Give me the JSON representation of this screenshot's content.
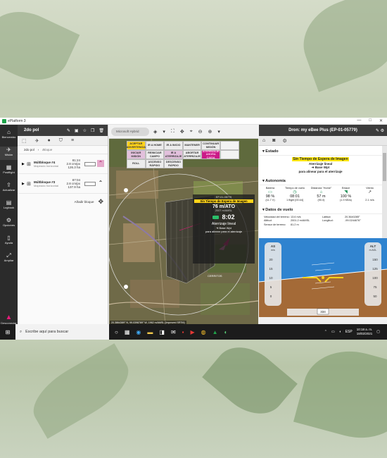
{
  "window": {
    "title": "ePlatform 3",
    "controls": [
      "—",
      "□",
      "✕"
    ]
  },
  "nav": {
    "items": [
      {
        "label": "Bienvenido",
        "icon": "home-icon"
      },
      {
        "label": "Misión",
        "icon": "route-icon"
      },
      {
        "label": "Postflight",
        "icon": "postflight-icon"
      },
      {
        "label": "Actualizar",
        "icon": "upload-icon"
      },
      {
        "label": "Logbook",
        "icon": "logbook-icon"
      },
      {
        "label": "Opciones",
        "icon": "gear-icon"
      },
      {
        "label": "Ayuda",
        "icon": "book-icon"
      },
      {
        "label": "Ampliar",
        "icon": "expand-icon"
      }
    ],
    "disconnect": {
      "label": "Desconectar",
      "icon": "drone-icon"
    }
  },
  "mission": {
    "title": "2do pol",
    "path": "2do pol",
    "sub": "Bloque",
    "blocks": [
      {
        "name": "Múltbloque #4",
        "type": "Mapeado horizontal",
        "v1": "81:24",
        "v2": "2.8 cm/px",
        "v3": "126.3 ha"
      },
      {
        "name": "Múltbloque #3",
        "type": "Mapeado horizontal",
        "v1": "87:04",
        "v2": "2.8 cm/px",
        "v3": "137.9 ha"
      }
    ],
    "add_label": "Añadir bloque"
  },
  "map": {
    "basemap": "Microsoft Hybrid",
    "commands": [
      [
        "ACEPTAR ADVERTENCIA",
        "IR A HOME",
        "IR A INICIO",
        "MANTENER",
        "CONTINUAR MISIÓN"
      ],
      [
        "INICIAR MISIÓN",
        "REINICIAR CAMPO",
        "IR A ATERRIZAJE",
        "ABORTAR ATERRIZAJE",
        "ATERRIZAJE AHORA CAIDA"
      ],
      [
        "ROLL",
        "ASCENSO RÁPIDO",
        "DESCENSO RÁPIDO"
      ]
    ],
    "overlay": {
      "id": "EP-01-05779",
      "status": "Sin Tiempo de Espera de Imagen",
      "altitude": "76 m/ATO",
      "alt_sub": "2007 m/AMSL",
      "time": "8:02",
      "mode": "Aterrizaje lineal",
      "target": "➔ Base Wpt",
      "note": "para alinear para el aterrizaje"
    },
    "labels": [
      "CERRITOS"
    ],
    "statusline": "20.3864389° N, 99.0398789° W, 1962 m/AMSL (Improved SRTM)"
  },
  "drone": {
    "title": "Dron: my eBee Plus (EP-01-05779)",
    "estado": {
      "heading": "Estado",
      "highlight": "Sin Tiempo de Espera de Imagen",
      "mode": "Aterrizaje lineal",
      "target": "➔ Base Wpt",
      "note": "para alinear para el aterrizaje"
    },
    "autonomia": {
      "heading": "Autonomía",
      "cols": [
        {
          "label": "Batería",
          "value": "98 %",
          "sub": "(11.7 V)"
        },
        {
          "label": "Tiempo de vuelo",
          "value": "08:01",
          "sub": "1 flight [00:44]"
        },
        {
          "label": "Distancia \"Home\"",
          "value": "57 m",
          "sub": "(90.0)"
        },
        {
          "label": "Enlace",
          "value": "100 %",
          "sub": "(1.9 KB/s)"
        },
        {
          "label": "Viento",
          "value": "",
          "sub": "2.1 m/s"
        }
      ]
    },
    "datos": {
      "heading": "Datos de vuelo",
      "rows": [
        [
          "Velocidad del terreno:",
          "13.6 m/s",
          "Latitud:",
          "20.3640285°"
        ],
        [
          "Altitud:",
          "2001.2 m/AMSL",
          "Longitud:",
          "-99.0244676°"
        ],
        [
          "Sensor de terreno:",
          "81.2 m",
          "",
          ""
        ]
      ]
    },
    "pfd": {
      "as_label": "AS",
      "as_unit": "m/s",
      "alt_label": "ALT",
      "alt_unit": "m AGL",
      "speed_ticks": [
        "20",
        "15",
        "10",
        "5",
        "0"
      ],
      "alt_ticks": [
        "150",
        "125",
        "100",
        "75",
        "50"
      ],
      "heading": "334"
    }
  },
  "taskbar": {
    "search_placeholder": "Escribe aquí para buscar",
    "lang": "ESP",
    "time": "10:18 a. m.",
    "date": "18/02/2021"
  },
  "colors": {
    "accent": "#e51b7a",
    "sky": "#2f83cf",
    "ground": "#a46a37",
    "warning": "#ffd31a"
  }
}
